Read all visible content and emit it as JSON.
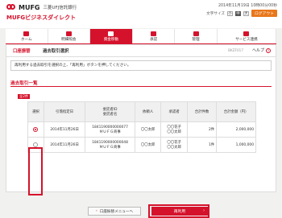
{
  "header": {
    "logo_text": "MUFG",
    "bank_name": "三菱UFJ信託銀行",
    "service_name": "MUFGビジネスダイレクト",
    "datetime": "2014年11月19日 10時00分00秒",
    "font_size_label": "文字サイズ",
    "font_sizes": [
      "小",
      "中",
      "大"
    ],
    "logout_label": "ログアウト"
  },
  "nav": {
    "items": [
      {
        "label": "ホーム",
        "icon": "home-icon"
      },
      {
        "label": "明細照会",
        "icon": "document-icon"
      },
      {
        "label": "資金移動",
        "icon": "transfer-icon"
      },
      {
        "label": "承認",
        "icon": "approve-icon"
      },
      {
        "label": "管理",
        "icon": "gear-icon"
      },
      {
        "label": "サービス連携",
        "icon": "link-icon"
      }
    ],
    "active_index": 2
  },
  "title_bar": {
    "category": "口座振替",
    "page": "過去取引選択",
    "code": "BKZF017",
    "help": "ヘルプ"
  },
  "instruction": "再利用する過去取引を選択の上、「再利用」ボタンを押してください。",
  "section": {
    "title": "過去取引一覧",
    "count_badge": "全2件"
  },
  "table": {
    "headers": [
      "選択",
      "引落指定日",
      "委託者ID\n委託者名",
      "依頼人",
      "承認者",
      "合計件数",
      "合計金額（円）"
    ],
    "rows": [
      {
        "selected": true,
        "date": "2014年11月26日",
        "client_id": "1841190000000077",
        "client_name": "ＭＵＦＧ商事",
        "requester": "〇〇太郎",
        "approver": "〇〇花子\n〇〇太郎",
        "count": "2件",
        "amount": "2,000,000"
      },
      {
        "selected": false,
        "date": "2014年11月26日",
        "client_id": "1841190000000048",
        "client_name": "ＭＵＦＧ商事",
        "requester": "〇〇太郎",
        "approver": "〇〇花子\n〇〇太郎",
        "count": "1件",
        "amount": "1,000,000"
      }
    ]
  },
  "buttons": {
    "back": "口座振替メニューへ",
    "reuse": "再利用"
  },
  "colors": {
    "brand_red": "#d5122b",
    "logout_orange": "#e8771b"
  }
}
